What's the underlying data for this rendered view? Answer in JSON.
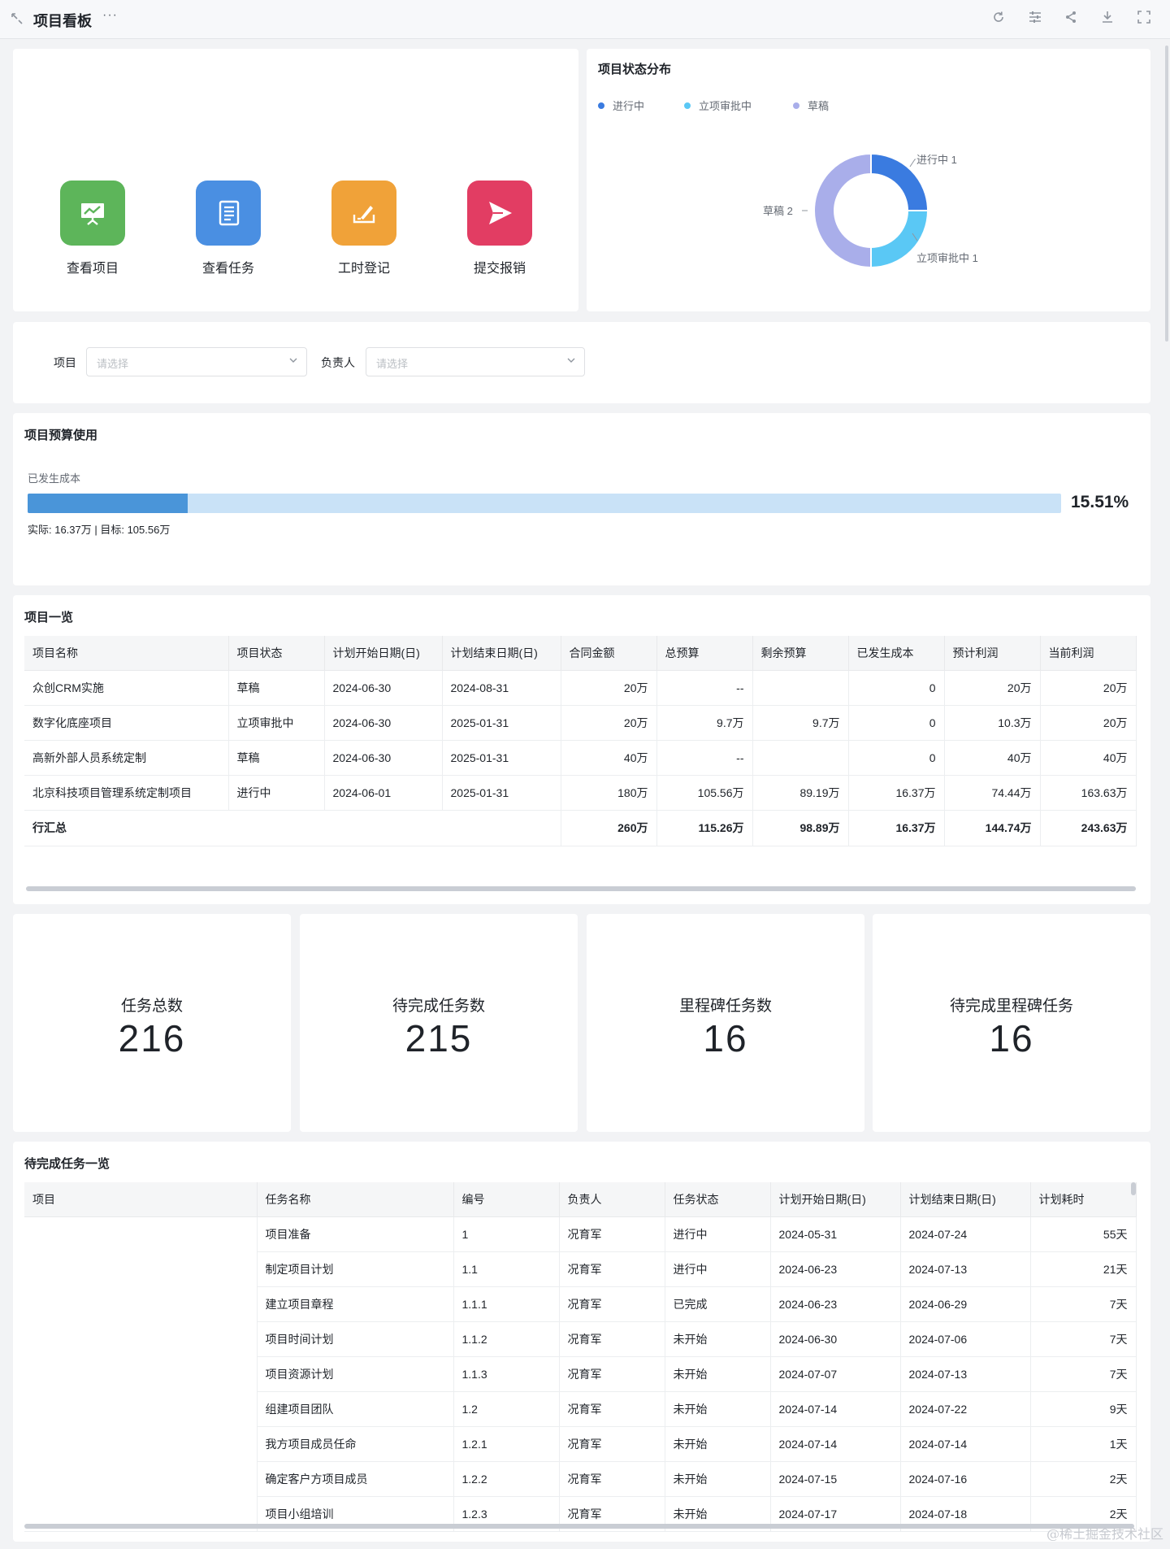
{
  "header": {
    "title": "项目看板",
    "more": "···"
  },
  "quick_actions": [
    {
      "label": "查看项目",
      "color": "#5db55a",
      "icon": "presentation-chart-icon"
    },
    {
      "label": "查看任务",
      "color": "#4a8fe2",
      "icon": "document-list-icon"
    },
    {
      "label": "工时登记",
      "color": "#f0a239",
      "icon": "sign-pen-icon"
    },
    {
      "label": "提交报销",
      "color": "#e23d63",
      "icon": "send-arrow-icon"
    }
  ],
  "status_chart": {
    "title": "项目状态分布",
    "legend": [
      {
        "name": "进行中",
        "color": "#3a7be0"
      },
      {
        "name": "立项审批中",
        "color": "#5ac8f5"
      },
      {
        "name": "草稿",
        "color": "#a9aeea"
      }
    ],
    "labels": {
      "running": "进行中  1",
      "approval": "立项审批中  1",
      "draft": "草稿  2"
    }
  },
  "chart_data": {
    "type": "pie",
    "categories": [
      "进行中",
      "立项审批中",
      "草稿"
    ],
    "values": [
      1,
      1,
      2
    ],
    "colors": [
      "#3a7be0",
      "#5ac8f5",
      "#a9aeea"
    ],
    "title": "项目状态分布",
    "legend": "top-left"
  },
  "filters": {
    "project_label": "项目",
    "project_placeholder": "请选择",
    "owner_label": "负责人",
    "owner_placeholder": "请选择"
  },
  "budget": {
    "title": "项目预算使用",
    "metric_label": "已发生成本",
    "percent_text": "15.51%",
    "percent_value": 15.51,
    "detail": "实际: 16.37万 | 目标: 105.56万"
  },
  "projects": {
    "title": "项目一览",
    "columns": [
      "项目名称",
      "项目状态",
      "计划开始日期(日)",
      "计划结束日期(日)",
      "合同金额",
      "总预算",
      "剩余预算",
      "已发生成本",
      "预计利润",
      "当前利润"
    ],
    "rows": [
      [
        "众创CRM实施",
        "草稿",
        "2024-06-30",
        "2024-08-31",
        "20万",
        "--",
        "",
        "0",
        "20万",
        "20万"
      ],
      [
        "数字化底座项目",
        "立项审批中",
        "2024-06-30",
        "2025-01-31",
        "20万",
        "9.7万",
        "9.7万",
        "0",
        "10.3万",
        "20万"
      ],
      [
        "高新外部人员系统定制",
        "草稿",
        "2024-06-30",
        "2025-01-31",
        "40万",
        "--",
        "",
        "0",
        "40万",
        "40万"
      ],
      [
        "北京科技项目管理系统定制项目",
        "进行中",
        "2024-06-01",
        "2025-01-31",
        "180万",
        "105.56万",
        "89.19万",
        "16.37万",
        "74.44万",
        "163.63万"
      ]
    ],
    "total": {
      "label": "行汇总",
      "values": [
        "260万",
        "115.26万",
        "98.89万",
        "16.37万",
        "144.74万",
        "243.63万"
      ]
    }
  },
  "kpis": [
    {
      "label": "任务总数",
      "value": "216"
    },
    {
      "label": "待完成任务数",
      "value": "215"
    },
    {
      "label": "里程碑任务数",
      "value": "16"
    },
    {
      "label": "待完成里程碑任务",
      "value": "16"
    }
  ],
  "tasks": {
    "title": "待完成任务一览",
    "columns": [
      "项目",
      "任务名称",
      "编号",
      "负责人",
      "任务状态",
      "计划开始日期(日)",
      "计划结束日期(日)",
      "计划耗时"
    ],
    "rows": [
      [
        "",
        "项目准备",
        "1",
        "况育军",
        "进行中",
        "2024-05-31",
        "2024-07-24",
        "55天"
      ],
      [
        "",
        "制定项目计划",
        "1.1",
        "况育军",
        "进行中",
        "2024-06-23",
        "2024-07-13",
        "21天"
      ],
      [
        "",
        "建立项目章程",
        "1.1.1",
        "况育军",
        "已完成",
        "2024-06-23",
        "2024-06-29",
        "7天"
      ],
      [
        "",
        "项目时间计划",
        "1.1.2",
        "况育军",
        "未开始",
        "2024-06-30",
        "2024-07-06",
        "7天"
      ],
      [
        "",
        "项目资源计划",
        "1.1.3",
        "况育军",
        "未开始",
        "2024-07-07",
        "2024-07-13",
        "7天"
      ],
      [
        "",
        "组建项目团队",
        "1.2",
        "况育军",
        "未开始",
        "2024-07-14",
        "2024-07-22",
        "9天"
      ],
      [
        "",
        "我方项目成员任命",
        "1.2.1",
        "况育军",
        "未开始",
        "2024-07-14",
        "2024-07-14",
        "1天"
      ],
      [
        "",
        "确定客户方项目成员",
        "1.2.2",
        "况育军",
        "未开始",
        "2024-07-15",
        "2024-07-16",
        "2天"
      ],
      [
        "",
        "项目小组培训",
        "1.2.3",
        "况育军",
        "未开始",
        "2024-07-17",
        "2024-07-18",
        "2天"
      ]
    ]
  },
  "watermark": "@稀土掘金技术社区"
}
